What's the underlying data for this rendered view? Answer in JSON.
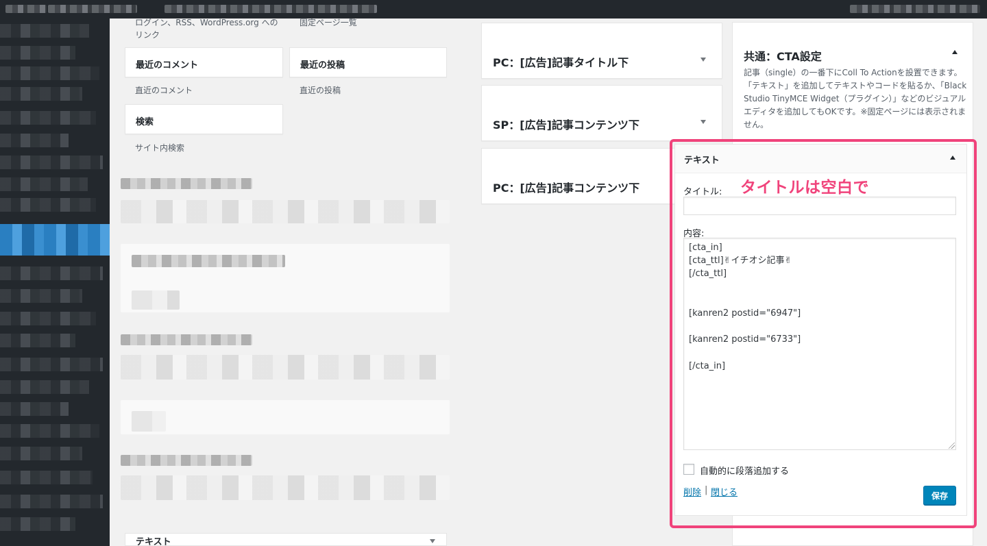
{
  "available_widgets": {
    "meta_desc": "ログイン、RSS、WordPress.org へのリンク",
    "pages_desc": "固定ページ一覧",
    "items": [
      {
        "title": "最近のコメント",
        "desc": "直近のコメント"
      },
      {
        "title": "最近の投稿",
        "desc": "直近の投稿"
      },
      {
        "title": "検索",
        "desc": "サイト内検索"
      }
    ],
    "bottom_tile": "テキスト"
  },
  "widget_areas": [
    {
      "title": "PC：[広告]記事タイトル下"
    },
    {
      "title": "SP：[広告]記事コンテンツ下"
    },
    {
      "title": "PC：[広告]記事コンテンツ下"
    }
  ],
  "cta_area": {
    "title": "共通：CTA設定",
    "description": "記事（single）の一番下にColl To Actionを設置できます。「テキスト」を追加してテキストやコードを貼るか、「Black Studio TinyMCE Widget（プラグイン）」などのビジュアルエディタを追加してもOKです。※固定ページには表示されません。"
  },
  "text_widget": {
    "header": "テキスト",
    "title_label": "タイトル:",
    "title_value": "",
    "content_label": "内容:",
    "content_value": "[cta_in]\n[cta_ttl]✌イチオシ記事✌\n[/cta_ttl]\n\n\n[kanren2 postid=\"6947\"]\n\n[kanren2 postid=\"6733\"]\n\n[/cta_in]",
    "autop_label": "自動的に段落追加する",
    "delete_link": "削除",
    "separator": "|",
    "close_link": "閉じる",
    "save_button": "保存"
  },
  "annotation": "タイトルは空白で",
  "colors": {
    "highlight": "#f0437b",
    "primary_button": "#0085ba",
    "link": "#0073aa",
    "admin_bar": "#23282d"
  },
  "icons": {
    "collapse": "triangle-down-icon",
    "expand": "triangle-up-icon"
  }
}
